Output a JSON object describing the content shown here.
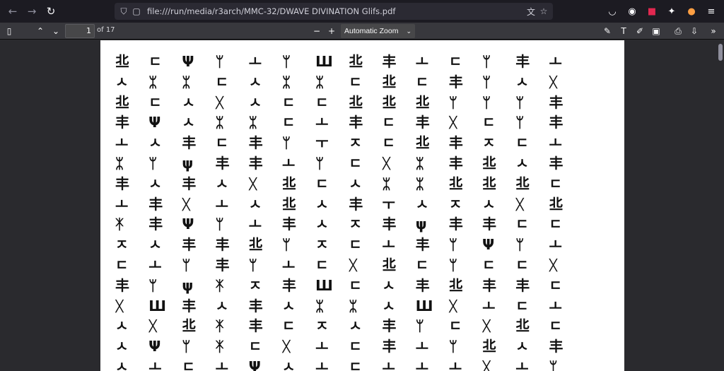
{
  "browser": {
    "url": "file:///run/media/r3arch/MMC-32/DWAVE DIVINATION Glifs.pdf",
    "icons": [
      "back-icon",
      "forward-icon",
      "reload-icon",
      "shield-icon",
      "page-icon",
      "translate-icon",
      "star-icon",
      "pocket-icon",
      "firefox-account-icon",
      "ublock-icon",
      "extensions-icon",
      "profile-icon",
      "menu-icon"
    ]
  },
  "pdf_toolbar": {
    "page_number": "1",
    "page_count": "of 17",
    "zoom": "Automatic Zoom",
    "icons": [
      "sidebar-toggle-icon",
      "previous-page-icon",
      "next-page-icon",
      "zoom-out-icon",
      "zoom-in-icon",
      "highlight-icon",
      "text-icon",
      "draw-icon",
      "image-icon",
      "print-icon",
      "save-icon",
      "more-tools-icon"
    ]
  },
  "glyph_symbols": [
    "丠",
    "ㄷ",
    "Ψ",
    "ᛘ",
    "ㅗ",
    "ᛘ",
    "Ш",
    "丠",
    "丰",
    "ㅗ",
    "ㄷ",
    "ᛘ",
    "丰",
    "ㅗ",
    "ㅅ",
    "ᛯ",
    "ᛯ",
    "ㄷ",
    "ㅅ",
    "ᛯ",
    "ᛯ",
    "ㄷ",
    "丠",
    "ㄷ",
    "丰",
    "ᛘ",
    "ㅅ",
    "ᚷ",
    "丠",
    "ㄷ",
    "ㅅ",
    "ᚷ",
    "ㅅ",
    "ㄷ",
    "ㄷ",
    "丠",
    "丠",
    "丠",
    "ᛘ",
    "ᛘ",
    "ᛘ",
    "丰",
    "丰",
    "Ψ",
    "ㅅ",
    "ᛯ",
    "ᛯ",
    "ㄷ",
    "ㅗ",
    "丰",
    "ㄷ",
    "丰",
    "ᚷ",
    "ㄷ",
    "ᛘ",
    "丰",
    "ㅗ",
    "ㅅ",
    "丰",
    "ㄷ",
    "丰",
    "ᛘ",
    "ㅜ",
    "ㅈ",
    "ㄷ",
    "丠",
    "丰",
    "ㅈ",
    "ㄷ",
    "ㅗ",
    "ᛯ",
    "ᛘ",
    "ψ",
    "丰",
    "丰",
    "ㅗ",
    "ᛘ",
    "ㄷ",
    "ᚷ",
    "ᛯ",
    "丰",
    "丠",
    "ㅅ",
    "丰",
    "丰",
    "ㅅ",
    "丰",
    "ㅅ",
    "ᚷ",
    "丠",
    "ㄷ",
    "ㅅ",
    "ᛯ",
    "ᛯ",
    "丠",
    "丠",
    "丠",
    "ㄷ",
    "ㅗ",
    "丰",
    "ᚷ",
    "ㅗ",
    "ㅅ",
    "丠",
    "ㅅ",
    "丰",
    "ㅜ",
    "ㅅ",
    "ㅈ",
    "ㅅ",
    "ᚷ",
    "丠",
    "ᛡ",
    "丰",
    "Ψ",
    "ᛘ",
    "ㅗ",
    "丰",
    "ㅅ",
    "ㅈ",
    "丰",
    "ψ",
    "丰",
    "丰",
    "ㄷ",
    "ㄷ",
    "ㅈ",
    "ㅅ",
    "丰",
    "丰",
    "丠",
    "ᛘ",
    "ㅈ",
    "ㄷ",
    "ㅗ",
    "丰",
    "ᛘ",
    "Ψ",
    "ᛘ",
    "ㅗ",
    "ㄷ",
    "ㅗ",
    "ᛘ",
    "丰",
    "ᛘ",
    "ㅗ",
    "ㄷ",
    "ᚷ",
    "丠",
    "ㄷ",
    "ᛘ",
    "ㄷ",
    "ㄷ",
    "ᚷ",
    "丰",
    "ᛘ",
    "ψ",
    "ᛡ",
    "ㅈ",
    "丰",
    "Ш",
    "ㄷ",
    "ㅅ",
    "丰",
    "丠",
    "丰",
    "丰",
    "ㄷ",
    "ᚷ",
    "Ш",
    "丰",
    "ㅅ",
    "丰",
    "ㅅ",
    "ᛯ",
    "ᛯ",
    "ㅅ",
    "Ш",
    "ᚷ",
    "ㅗ",
    "ㄷ",
    "ㅗ",
    "ㅅ",
    "ᚷ",
    "丠",
    "ᛡ",
    "丰",
    "ㄷ",
    "ㅈ",
    "ㅅ",
    "丰",
    "ᛘ",
    "ㄷ",
    "ᚷ",
    "丠",
    "ㄷ",
    "ㅅ",
    "Ψ",
    "ᛘ",
    "ᛡ",
    "ㄷ",
    "ᚷ",
    "ㅗ",
    "ㄷ",
    "丰",
    "ㅗ",
    "ᛘ",
    "丠",
    "ㅅ",
    "丰",
    "ㅅ",
    "ㅗ",
    "ㄷ",
    "ㅗ",
    "Ψ",
    "ㅅ",
    "ㅗ",
    "ㄷ",
    "ㅗ",
    "ㅗ",
    "ㅗ",
    "ᚷ",
    "ㅗ",
    "ᛘ"
  ]
}
